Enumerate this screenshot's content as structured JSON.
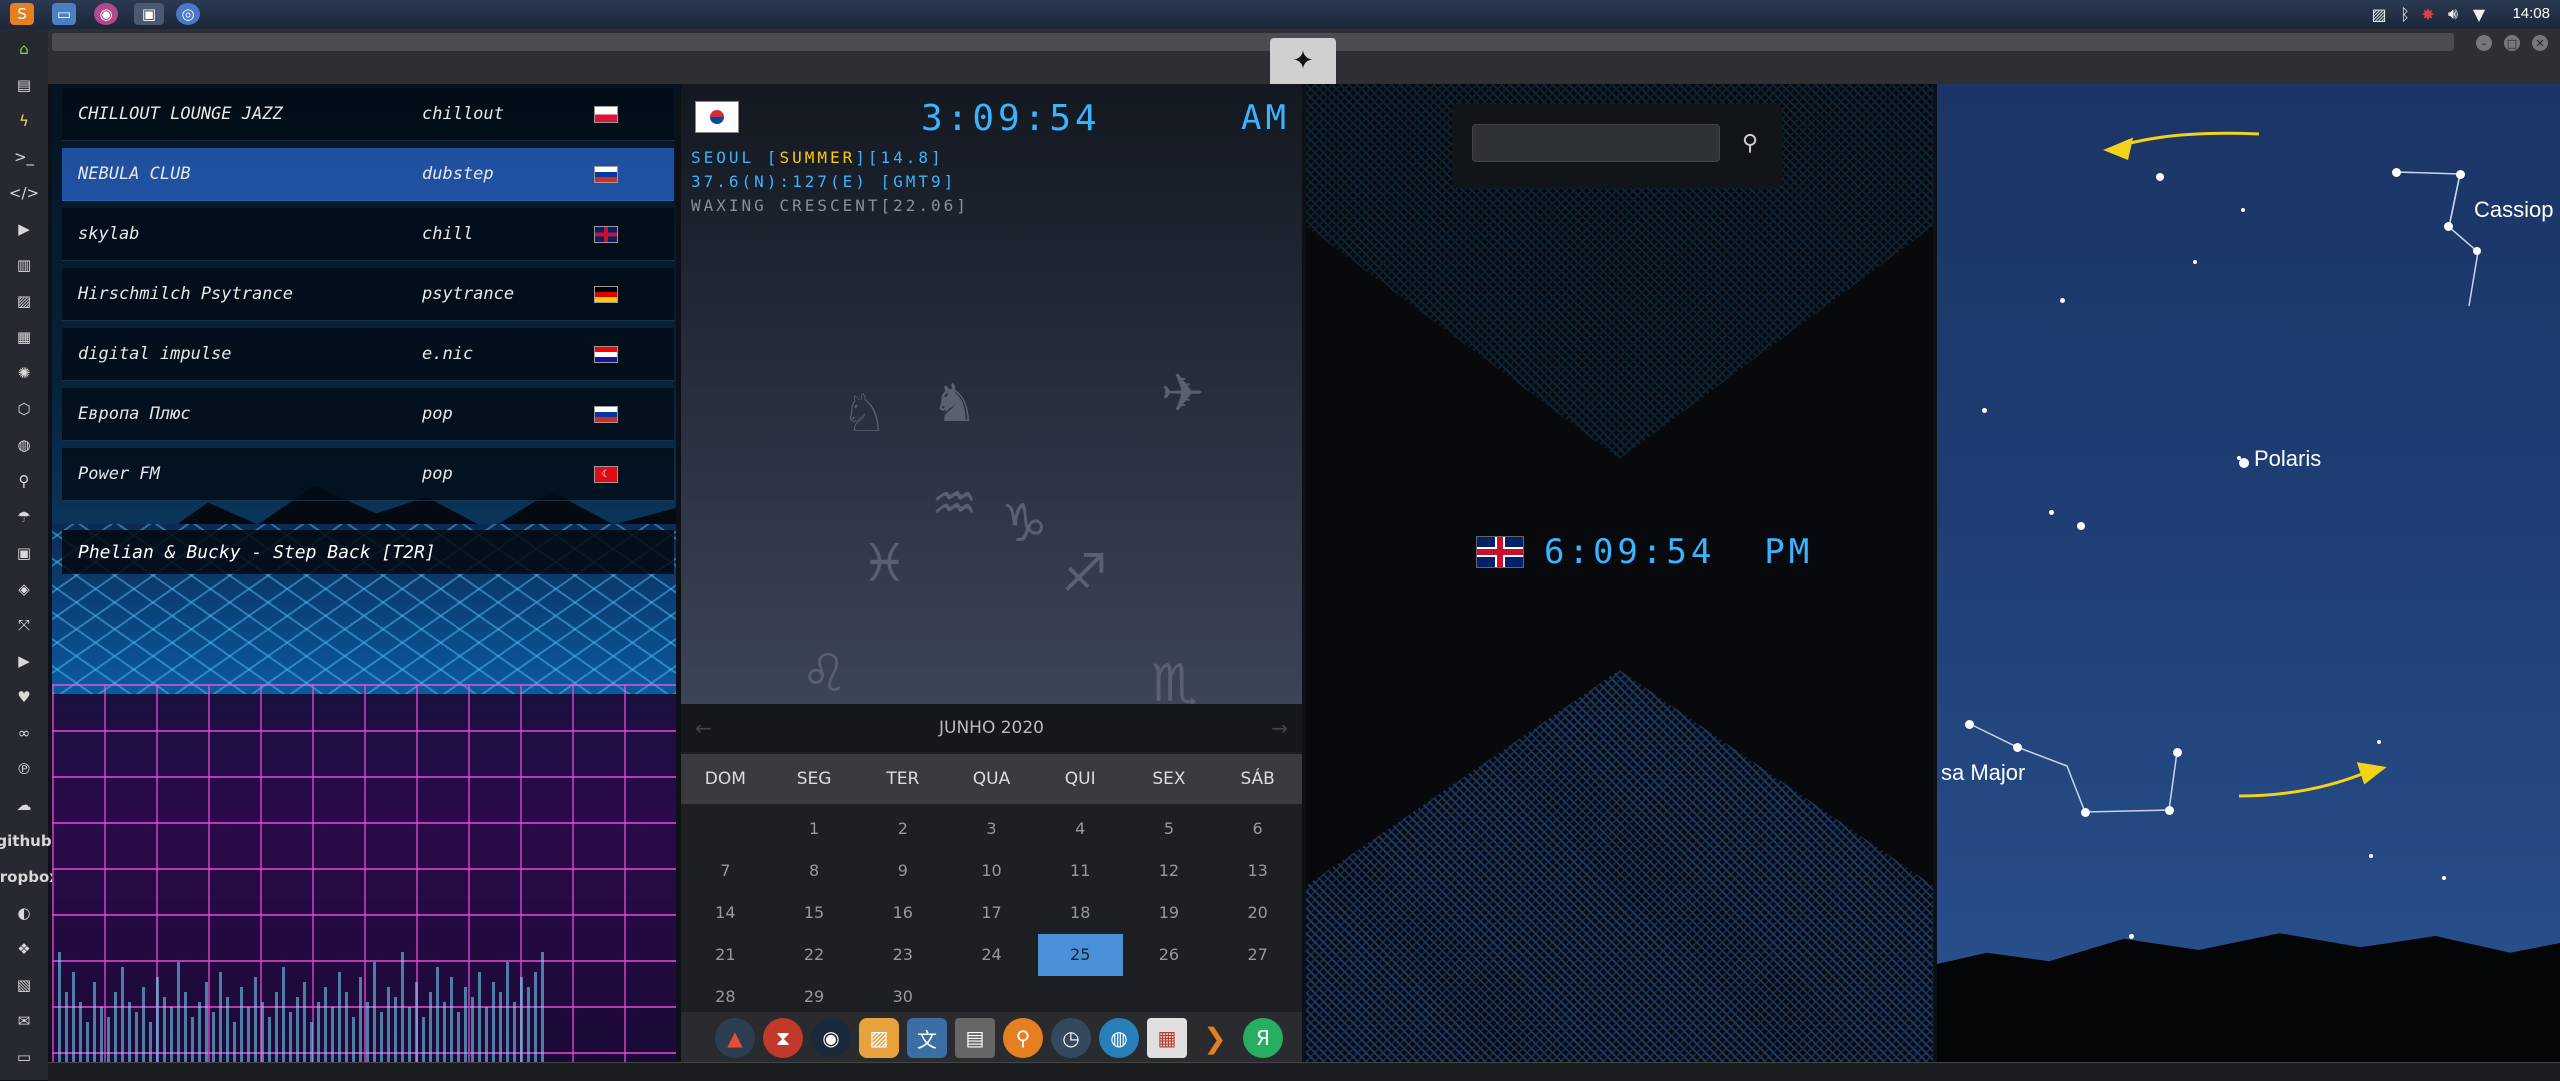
{
  "topbar": {
    "clock": "14:08",
    "launchers": [
      "sublime-icon",
      "files-icon",
      "app-icon",
      "window-icon",
      "chrome-icon"
    ]
  },
  "window": {
    "emblem": "rebel-alliance-icon"
  },
  "sidebar": {
    "icons": [
      "home",
      "file",
      "bolt",
      "terminal",
      "code",
      "play",
      "book",
      "image",
      "news",
      "settings",
      "hexagon",
      "globe",
      "search",
      "umbrella",
      "contacts",
      "tag",
      "expand",
      "youtube",
      "heart",
      "infinity",
      "pinterest",
      "cloud",
      "Bē",
      "git",
      "github",
      "dropbox",
      "map",
      "mail",
      "monitor"
    ]
  },
  "radio": {
    "stations": [
      {
        "name": "CHILLOUT LOUNGE JAZZ",
        "genre": "chillout",
        "flag": "pl"
      },
      {
        "name": "NEBULA CLUB",
        "genre": "dubstep",
        "flag": "ru",
        "selected": true
      },
      {
        "name": "skylab",
        "genre": "chill",
        "flag": "uk"
      },
      {
        "name": "Hirschmilch Psytrance",
        "genre": "psytrance",
        "flag": "de"
      },
      {
        "name": "digital impulse",
        "genre": "e.nic",
        "flag": "hr"
      },
      {
        "name": "Европа Плюс",
        "genre": "pop",
        "flag": "ru"
      },
      {
        "name": "Power FM",
        "genre": "pop",
        "flag": "tr"
      }
    ],
    "now_playing": "Phelian & Bucky - Step Back [T2R]"
  },
  "seoul": {
    "time": "3:09:54",
    "ampm": "AM",
    "line1_prefix": "SEOUL [",
    "line1_season": "SUMMER",
    "line1_suffix": "][14.8]",
    "line2": "37.6(N):127(E) [GMT9]",
    "line3": "WAXING CRESCENT[22.06]"
  },
  "calendar": {
    "month": "JUNHO 2020",
    "prev": "←",
    "next": "→",
    "weekdays": [
      "DOM",
      "SEG",
      "TER",
      "QUA",
      "QUI",
      "SEX",
      "SÁB"
    ],
    "days": [
      "",
      "1",
      "2",
      "3",
      "4",
      "5",
      "6",
      "7",
      "8",
      "9",
      "10",
      "11",
      "12",
      "13",
      "14",
      "15",
      "16",
      "17",
      "18",
      "19",
      "20",
      "21",
      "22",
      "23",
      "24",
      "25",
      "26",
      "27",
      "28",
      "29",
      "30",
      "",
      "",
      "",
      ""
    ],
    "today": "25"
  },
  "dock": {
    "apps": [
      "arch-icon",
      "hourglass-icon",
      "earth-icon",
      "photos-icon",
      "translate-icon",
      "news-icon",
      "magnifier-icon",
      "clock-icon",
      "globe-icon",
      "calendar-icon",
      "arrow-icon",
      "yandex-icon"
    ]
  },
  "london": {
    "time": "6:09:54",
    "ampm": "PM",
    "search_placeholder": ""
  },
  "sky": {
    "labels": {
      "cassiopeia": "Cassiop",
      "polaris": "Polaris",
      "ursa": "sa Major"
    }
  }
}
